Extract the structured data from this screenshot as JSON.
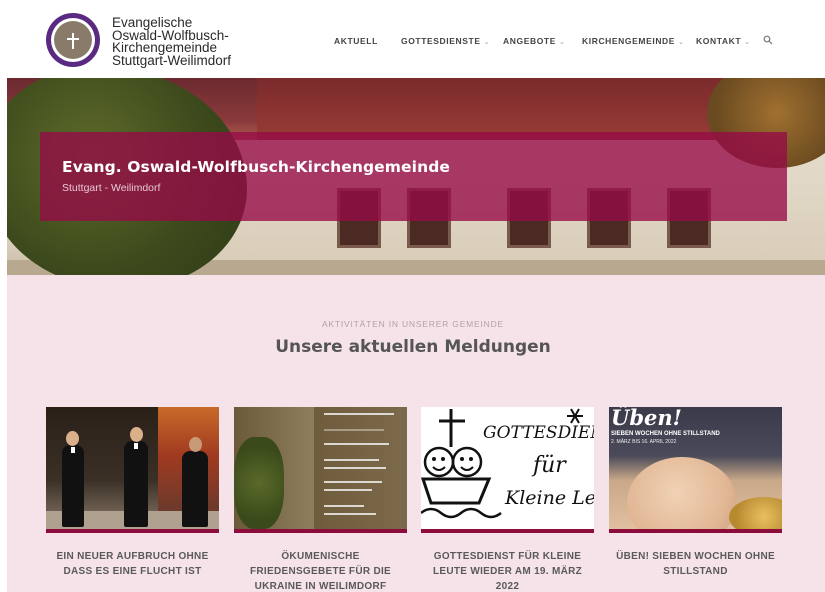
{
  "brand": {
    "lines": [
      "Evangelische",
      "Oswald-Wolfbusch-",
      "Kirchengemeinde",
      "Stuttgart-Weilimdorf"
    ],
    "logo_icon": "church-cross-logo"
  },
  "nav": {
    "items": [
      {
        "label": "AKTUELL",
        "dropdown": false
      },
      {
        "label": "GOTTESDIENSTE",
        "dropdown": true
      },
      {
        "label": "ANGEBOTE",
        "dropdown": true
      },
      {
        "label": "KIRCHENGEMEINDE",
        "dropdown": true
      },
      {
        "label": "KONTAKT",
        "dropdown": true
      }
    ],
    "search_icon": "search-icon"
  },
  "hero": {
    "title": "Evang. Oswald-Wolfbusch-Kirchengemeinde",
    "subtitle": "Stuttgart - Weilimdorf"
  },
  "section": {
    "kicker": "AKTIVITÄTEN IN UNSERER GEMEINDE",
    "headline": "Unsere aktuellen Meldungen"
  },
  "cards": [
    {
      "title": "EIN NEUER AUFBRUCH OHNE DASS ES EINE FLUCHT IST"
    },
    {
      "title": "ÖKUMENISCHE FRIEDENSGEBETE FÜR DIE UKRAINE IN WEILIMDORF"
    },
    {
      "title": "GOTTESDIENST FÜR KLEINE LEUTE WIEDER AM 19. MÄRZ 2022",
      "image_text": [
        "GOTTESDIENST",
        "für",
        "Kleine Leute"
      ]
    },
    {
      "title": "ÜBEN! SIEBEN WOCHEN OHNE STILLSTAND",
      "image_text": [
        "Üben!",
        "SIEBEN WOCHEN OHNE STILLSTAND",
        "2. MÄRZ BIS 16. APRIL 2022"
      ]
    }
  ],
  "colors": {
    "accent": "#8c0c3c",
    "hero_banner": "#960a46",
    "section_bg": "#f5e3e9",
    "logo": "#5a2a82"
  }
}
